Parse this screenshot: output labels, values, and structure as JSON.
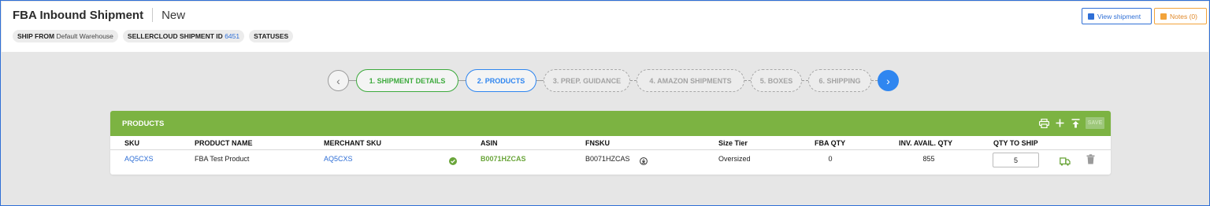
{
  "header": {
    "title": "FBA Inbound Shipment",
    "subtitle": "New",
    "chips": {
      "ship_from_label": "SHIP FROM",
      "ship_from_value": "Default Warehouse",
      "shipment_id_label": "SELLERCLOUD SHIPMENT ID",
      "shipment_id_value": "6451",
      "statuses_label": "STATUSES"
    },
    "view_shipment_label": "View shipment",
    "notes_label": "Notes (0)"
  },
  "steps": {
    "prev_icon": "chevron-left-icon",
    "next_icon": "chevron-right-icon",
    "items": [
      {
        "label": "1. SHIPMENT DETAILS",
        "state": "done"
      },
      {
        "label": "2. PRODUCTS",
        "state": "active"
      },
      {
        "label": "3. PREP. GUIDANCE",
        "state": "pending"
      },
      {
        "label": "4. AMAZON SHIPMENTS",
        "state": "pending"
      },
      {
        "label": "5. BOXES",
        "state": "pending"
      },
      {
        "label": "6. SHIPPING",
        "state": "pending"
      }
    ]
  },
  "products": {
    "title": "PRODUCTS",
    "save_label": "SAVE",
    "columns": {
      "sku": "SKU",
      "product_name": "PRODUCT NAME",
      "merchant_sku": "MERCHANT SKU",
      "asin": "ASIN",
      "fnsku": "FNSKU",
      "size_tier": "Size Tier",
      "fba_qty": "FBA QTY",
      "inv_avail_qty": "INV. AVAIL. QTY",
      "qty_to_ship": "QTY TO SHIP"
    },
    "rows": [
      {
        "sku": "AQ5CXS",
        "product_name": "FBA Test Product",
        "merchant_sku": "AQ5CXS",
        "asin": "B0071HZCAS",
        "fnsku": "B0071HZCAS",
        "size_tier": "Oversized",
        "fba_qty": "0",
        "inv_avail_qty": "855",
        "qty_to_ship": "5"
      }
    ]
  },
  "colors": {
    "accent_blue": "#2f6fd6",
    "step_next_blue": "#2f86f0",
    "done_green": "#3daa3d",
    "panel_green": "#7cb342",
    "notes_orange": "#f2a33a"
  }
}
